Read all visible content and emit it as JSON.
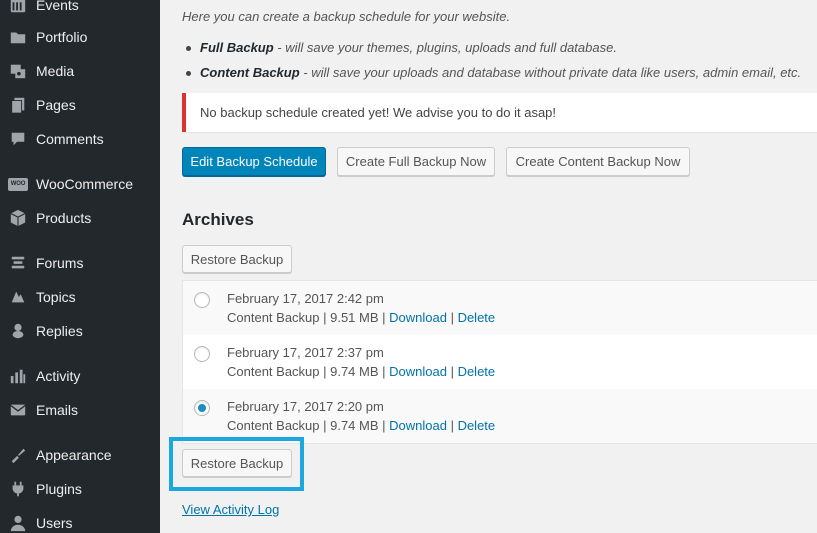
{
  "sidebar": {
    "items": [
      {
        "label": "Events",
        "icon": "calendar-icon"
      },
      {
        "label": "Portfolio",
        "icon": "portfolio-icon"
      },
      {
        "label": "Media",
        "icon": "media-icon"
      },
      {
        "label": "Pages",
        "icon": "pages-icon"
      },
      {
        "label": "Comments",
        "icon": "comments-icon"
      },
      {
        "label": "WooCommerce",
        "icon": "woocommerce-icon",
        "badge": "WOO"
      },
      {
        "label": "Products",
        "icon": "products-icon"
      },
      {
        "label": "Forums",
        "icon": "forums-icon"
      },
      {
        "label": "Topics",
        "icon": "topics-icon"
      },
      {
        "label": "Replies",
        "icon": "replies-icon"
      },
      {
        "label": "Activity",
        "icon": "activity-icon"
      },
      {
        "label": "Emails",
        "icon": "emails-icon"
      },
      {
        "label": "Appearance",
        "icon": "appearance-icon"
      },
      {
        "label": "Plugins",
        "icon": "plugins-icon"
      },
      {
        "label": "Users",
        "icon": "users-icon"
      }
    ]
  },
  "main": {
    "intro": "Here you can create a backup schedule for your website.",
    "bullets": [
      {
        "term": "Full Backup",
        "desc": " - will save your themes, plugins, uploads and full database."
      },
      {
        "term": "Content Backup",
        "desc": " - will save your uploads and database without private data like users, admin email, etc."
      }
    ],
    "notice": "No backup schedule created yet! We advise you to do it asap!",
    "buttons": {
      "edit_schedule": "Edit Backup Schedule",
      "create_full": "Create Full Backup Now",
      "create_content": "Create Content Backup Now"
    },
    "archives_title": "Archives",
    "restore_label": "Restore Backup",
    "backups": [
      {
        "date": "February 17, 2017 2:42 pm",
        "meta": "Content Backup | 9.51 MB | ",
        "selected": false
      },
      {
        "date": "February 17, 2017 2:37 pm",
        "meta": "Content Backup | 9.74 MB | ",
        "selected": false
      },
      {
        "date": "February 17, 2017 2:20 pm",
        "meta": "Content Backup | 9.74 MB | ",
        "selected": true
      }
    ],
    "download_label": "Download",
    "separator": " | ",
    "delete_label": "Delete",
    "activity_log": "View Activity Log"
  },
  "colors": {
    "sidebar_bg": "#23282d",
    "primary": "#0085ba",
    "notice_error": "#dc3232",
    "link": "#0073aa",
    "highlight": "#1ba8df"
  }
}
